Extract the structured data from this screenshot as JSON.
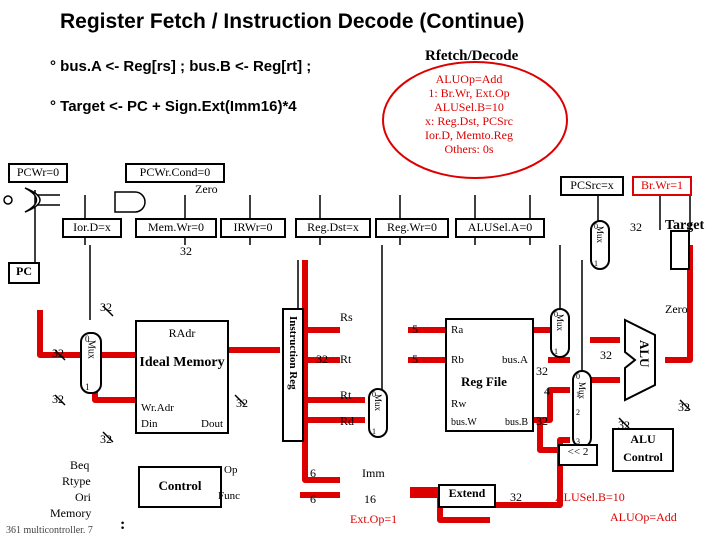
{
  "title": "Register Fetch / Instruction Decode  (Continue)",
  "line1": "°  bus.A <- Reg[rs] ; bus.B <- Reg[rt] ;",
  "line2": "°  Target <- PC + Sign.Ext(Imm16)*4",
  "rfetch": "Rfetch/Decode",
  "callout": {
    "l1": "ALUOp=Add",
    "l2": "1: Br.Wr, Ext.Op",
    "l3": "ALUSel.B=10",
    "l4": "x: Reg.Dst, PCSrc",
    "l5": "Ior.D, Memto.Reg",
    "l6": "Others: 0s"
  },
  "sig": {
    "pcwr": "PCWr=0",
    "pcwrcond": "PCWr.Cond=0",
    "zero": "Zero",
    "iord": "Ior.D=x",
    "memwr": "Mem.Wr=0",
    "irwr": "IRWr=0",
    "regdst": "Reg.Dst=x",
    "regwr": "Reg.Wr=0",
    "alusela": "ALUSel.A=0",
    "pcsrc": "PCSrc=x",
    "brwr": "Br.Wr=1",
    "target": "Target",
    "aluselb": "ALUSel.B=10",
    "aluop": "ALUOp=Add",
    "extop": "Ext.Op=1"
  },
  "blk": {
    "pc": "PC",
    "radr": "RAdr",
    "ideal": "Ideal Memory",
    "wradr": "Wr.Adr",
    "din": "Din",
    "dout": "Dout",
    "ireg": "Instruction Reg",
    "regfile": "Reg File",
    "ra": "Ra",
    "rb": "Rb",
    "rw": "Rw",
    "busw": "bus.W",
    "busa": "bus.A",
    "busb": "bus.B",
    "alu": "ALU",
    "aluctrl": "ALU Control",
    "control": "Control",
    "op": "Op",
    "func": "Func",
    "extend": "Extend",
    "mux": "Mux",
    "imm": "Imm",
    "shift": "<< 2",
    "rs": "Rs",
    "rt": "Rt",
    "rd": "Rd",
    "zero2": "Zero"
  },
  "num": {
    "n32": "32",
    "n5": "5",
    "n4": "4",
    "n6": "6",
    "n16": "16",
    "n0": "0",
    "n1": "1",
    "n2": "2",
    "n3": "3"
  },
  "left": {
    "beq": "Beq",
    "rtype": "Rtype",
    "ori": "Ori",
    "memory": "Memory",
    "colon": ":"
  },
  "footer": "361 multicontroller. 7"
}
